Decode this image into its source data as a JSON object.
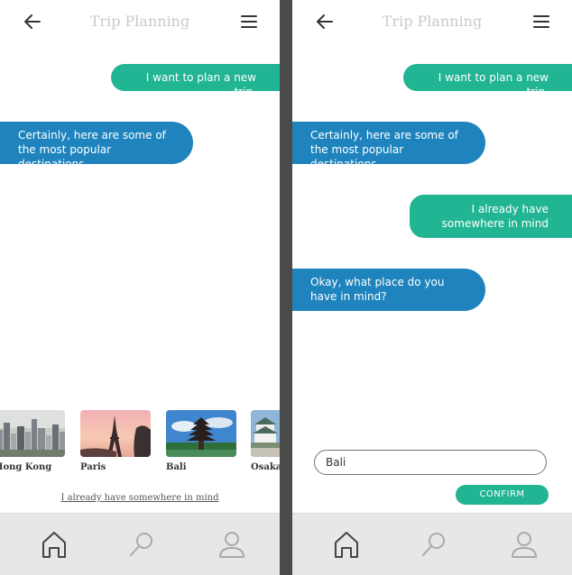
{
  "left_screen": {
    "title": "Trip Planning",
    "messages": [
      {
        "from": "user",
        "text": "I want to plan a new trip."
      },
      {
        "from": "bot",
        "text": "Certainly, here are  some of the most popular destinations"
      }
    ],
    "destinations": [
      {
        "label": "Hong Kong",
        "visible_label": "Hong Kong"
      },
      {
        "label": "Paris"
      },
      {
        "label": "Bali"
      },
      {
        "label": "Osaka"
      }
    ],
    "link_text": "I already have somewhere in mind"
  },
  "right_screen": {
    "title": "Trip Planning",
    "messages": [
      {
        "from": "user",
        "text": "I want to plan a new trip."
      },
      {
        "from": "bot",
        "text": "Certainly, here are  some of the most popular destinations"
      },
      {
        "from": "user",
        "text": "I already have somewhere in mind"
      },
      {
        "from": "bot",
        "text": "Okay, what place do you have in mind?"
      }
    ],
    "input_value": "Bali",
    "confirm_label": "CONFIRM"
  },
  "nav": {
    "icons": [
      "home-icon",
      "search-icon",
      "profile-icon"
    ]
  },
  "colors": {
    "user_bubble": "#22b593",
    "bot_bubble": "#1f84bd",
    "nav_bg": "#e7e7e7",
    "divider": "#4a4a4a"
  }
}
